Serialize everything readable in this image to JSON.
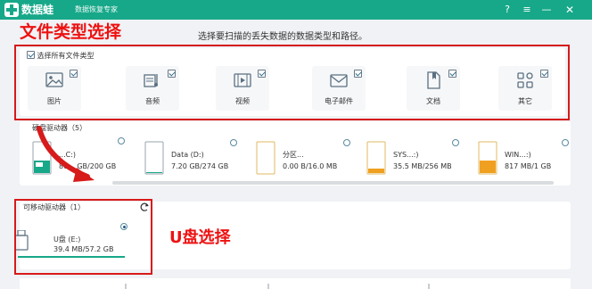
{
  "titlebar": {
    "app_name": "数据蛙",
    "app_sub": "数据恢复专家",
    "help": "?",
    "menu": "≡",
    "minimize": "—",
    "close": "✕",
    "bg_color": "#17a889"
  },
  "annotations": {
    "file_type_note": "文件类型选择",
    "usb_note": "U盘选择",
    "color": "#e11111"
  },
  "instruction": "选择要扫描的丢失数据的数据类型和路径。",
  "types": {
    "select_all": "选择所有文件类型",
    "items": [
      {
        "label": "图片",
        "icon": "image-icon",
        "checked": true
      },
      {
        "label": "音频",
        "icon": "audio-icon",
        "checked": true
      },
      {
        "label": "视频",
        "icon": "video-icon",
        "checked": true
      },
      {
        "label": "电子邮件",
        "icon": "email-icon",
        "checked": true
      },
      {
        "label": "文档",
        "icon": "document-icon",
        "checked": true
      },
      {
        "label": "其它",
        "icon": "other-icon",
        "checked": true
      }
    ]
  },
  "disks": {
    "title": "硬盘驱动器（5）",
    "items": [
      {
        "name": "...C:)",
        "size": "86... GB/200 GB",
        "used_fraction": 0.43,
        "selected": false
      },
      {
        "name": "Data (D:)",
        "size": "7.20 GB/274 GB",
        "used_fraction": 0.03,
        "selected": false
      },
      {
        "name": "分区...",
        "size": "0.00 B/16.0 MB",
        "used_fraction": 0.0,
        "selected": false
      },
      {
        "name": "SYS...:)",
        "size": "35.5 MB/256 MB",
        "used_fraction": 0.14,
        "selected": false
      },
      {
        "name": "WIN...:)",
        "size": "817 MB/1 GB",
        "used_fraction": 0.8,
        "selected": false
      }
    ]
  },
  "removable": {
    "title": "可移动驱动器（1）",
    "items": [
      {
        "name": "U盘 (E:)",
        "size": "39.4 MB/57.2 GB",
        "selected": true
      }
    ]
  }
}
